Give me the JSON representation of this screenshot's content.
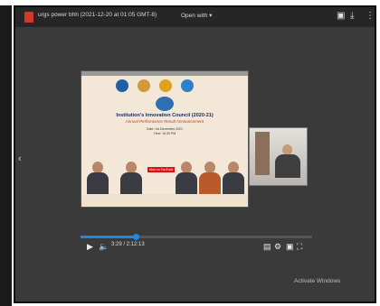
{
  "topbar": {
    "file_title": "urgs power bhh (2021-12-20 at 01:05 GMT-8)",
    "open_with": "Open with ▾",
    "icons": [
      "add-to-drive-icon",
      "download-icon",
      "more-options-icon"
    ]
  },
  "slide": {
    "title": "Institution's Innovation Council (2020-21)",
    "subtitle": "Annual Performance Result Announcement",
    "date_line": "Date: 1st December 2021",
    "time_line": "Time: 10:30 PM",
    "live_text": "Also on YouTube"
  },
  "player": {
    "time_display": "3:29 / 2:12:13",
    "progress": 0.24
  },
  "overlay": {
    "activate_windows": "Activate Windows"
  },
  "colors": {
    "accent": "#1e88e5",
    "topbar": "#262626",
    "viewer_bg": "#3a3a3a"
  }
}
